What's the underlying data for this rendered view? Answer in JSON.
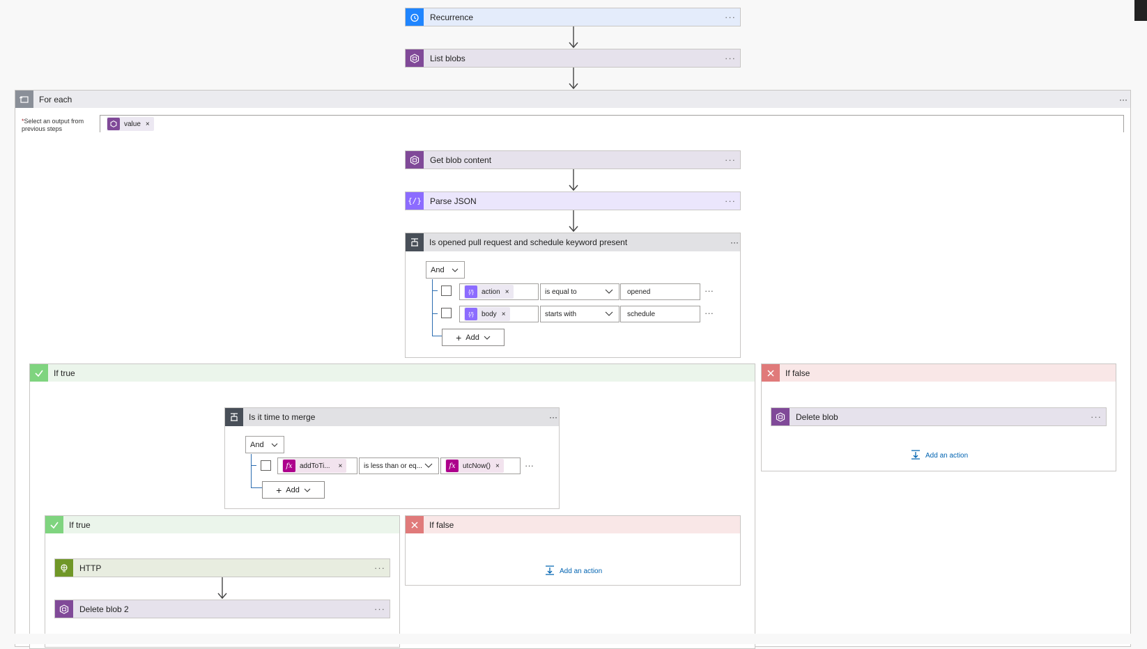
{
  "top_steps": {
    "recurrence": "Recurrence",
    "list_blobs": "List blobs"
  },
  "foreach": {
    "title": "For each",
    "select_label_required": "*",
    "select_label": "Select an output from previous steps",
    "token": "value",
    "get_blob_content": "Get blob content",
    "parse_json": "Parse JSON"
  },
  "condition1": {
    "title": "Is opened pull request and schedule keyword present",
    "group": "And",
    "rows": [
      {
        "token": "action",
        "operator": "is equal to",
        "value": "opened"
      },
      {
        "token": "body",
        "operator": "starts with",
        "value": "schedule"
      }
    ],
    "add": "Add"
  },
  "if_true_outer": {
    "label": "If true",
    "condition2": {
      "title": "Is it time to merge",
      "group": "And",
      "left_token": "addToTi...",
      "operator": "is less than or eq...",
      "right_token": "utcNow()",
      "add": "Add"
    },
    "if_true_inner": {
      "label": "If true",
      "http": "HTTP",
      "delete_blob_2": "Delete blob 2"
    },
    "if_false_inner": {
      "label": "If false",
      "add_action": "Add an action"
    }
  },
  "if_false_outer": {
    "label": "If false",
    "delete_blob": "Delete blob",
    "add_action": "Add an action"
  },
  "more": "···",
  "close": "×",
  "colors": {
    "blob": "#804998",
    "recurrence": "#1f85ff",
    "parse_json": "#8c6cff",
    "condition": "#484f58",
    "true_green": "#7fd47f",
    "false_red": "#e07a7a",
    "http": "#709727",
    "expression": "#ad008c"
  },
  "icons": {
    "recurrence": "alarm-clock-icon",
    "blob": "blob-storage-icon",
    "foreach": "loop-icon",
    "parse_json": "braces-icon",
    "condition": "condition-icon",
    "check": "check-icon",
    "cross": "cross-icon",
    "http": "globe-icon",
    "function": "fx-icon"
  }
}
